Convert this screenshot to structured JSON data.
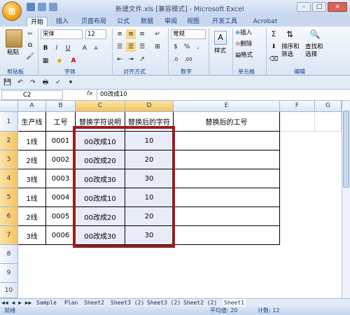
{
  "window": {
    "title": "新建文件.xls  [兼容模式] - Microsoft Excel",
    "office_btn": "⊞",
    "minimize": "–",
    "restore": "□",
    "close": "×"
  },
  "tabs": [
    "开始",
    "插入",
    "页面布局",
    "公式",
    "数据",
    "审阅",
    "视图",
    "开发工具",
    "Acrobat"
  ],
  "ribbon": {
    "paste_label": "粘贴",
    "font_name": "宋体",
    "font_size": "12",
    "number_format": "常规",
    "style_label": "样式",
    "insert_label": "插入",
    "delete_label": "删除",
    "format_label": "格式",
    "sum_icon": "Σ",
    "sort_filter_label": "排序和\n筛选",
    "find_select_label": "查找和\n选择",
    "group_clipboard": "剪贴板",
    "group_font": "字体",
    "group_alignment": "对齐方式",
    "group_number": "数字",
    "group_cells": "单元格",
    "group_editing": "编辑",
    "bold": "B",
    "italic": "I",
    "underline": "U",
    "grow_font": "A",
    "shrink_font": "A",
    "percent": "%",
    "comma": ",",
    "currency": "$"
  },
  "formula_bar": {
    "name_box": "C2",
    "fx": "fx",
    "value": "00改成10"
  },
  "columns": [
    "A",
    "B",
    "C",
    "D",
    "E",
    "F",
    "G"
  ],
  "rows": [
    "1",
    "2",
    "3",
    "4",
    "5",
    "6",
    "7",
    "8",
    "9",
    "10"
  ],
  "table": {
    "headers": [
      "生产线",
      "工号",
      "替换字符说明",
      "替换后的字符",
      "替换后的工号"
    ],
    "data": [
      [
        "1线",
        "0001",
        "00改成10",
        "10"
      ],
      [
        "2线",
        "0002",
        "00改成20",
        "20"
      ],
      [
        "3线",
        "0003",
        "00改成30",
        "30"
      ],
      [
        "1线",
        "0004",
        "00改成10",
        "10"
      ],
      [
        "2线",
        "0005",
        "00改成20",
        "20"
      ],
      [
        "3线",
        "0006",
        "00改成30",
        "30"
      ]
    ]
  },
  "sheets": [
    "Sample",
    "Plan",
    "Sheet2",
    "Sheet3 (2)",
    "Sheet3 (2)",
    "Sheet2 (2)",
    "Sheet1"
  ],
  "status": {
    "mode": "就绪",
    "average": "平均值: 20",
    "count": "计数: 12"
  },
  "colors": {
    "accent": "#15428b",
    "highlight_border": "#9b1c1f",
    "selected_header": "#f5c45f"
  }
}
